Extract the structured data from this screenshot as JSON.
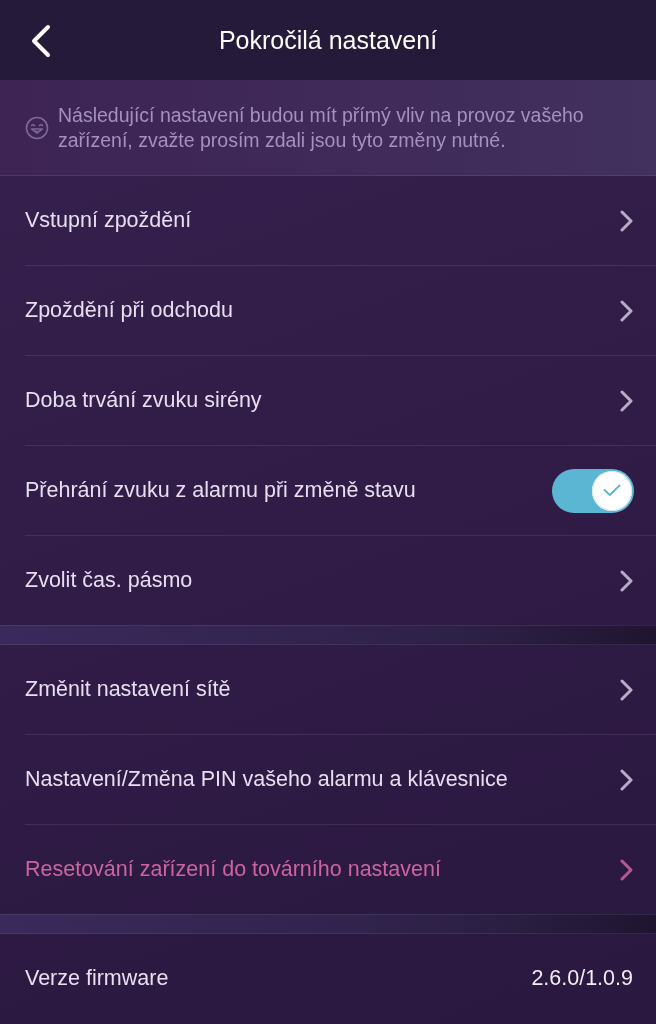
{
  "header": {
    "title": "Pokročilá nastavení"
  },
  "notice": {
    "text": "Následující nastavení budou mít přímý vliv na provoz vašeho zařízení, zvažte prosím zdali jsou tyto změny nutné."
  },
  "sections": [
    {
      "items": [
        {
          "kind": "link",
          "label": "Vstupní zpoždění"
        },
        {
          "kind": "link",
          "label": "Zpoždění při odchodu"
        },
        {
          "kind": "link",
          "label": "Doba trvání zvuku sirény"
        },
        {
          "kind": "toggle",
          "label": "Přehrání zvuku z alarmu při změně stavu",
          "on": true
        },
        {
          "kind": "link",
          "label": "Zvolit čas. pásmo"
        }
      ]
    },
    {
      "items": [
        {
          "kind": "link",
          "label": "Změnit nastavení sítě"
        },
        {
          "kind": "link",
          "label": "Nastavení/Změna PIN vašeho alarmu a klávesnice"
        },
        {
          "kind": "destructive",
          "label": "Resetování zařízení do továrního nastavení"
        }
      ]
    },
    {
      "items": [
        {
          "kind": "info",
          "label": "Verze firmware",
          "value": "2.6.0/1.0.9"
        }
      ]
    }
  ]
}
